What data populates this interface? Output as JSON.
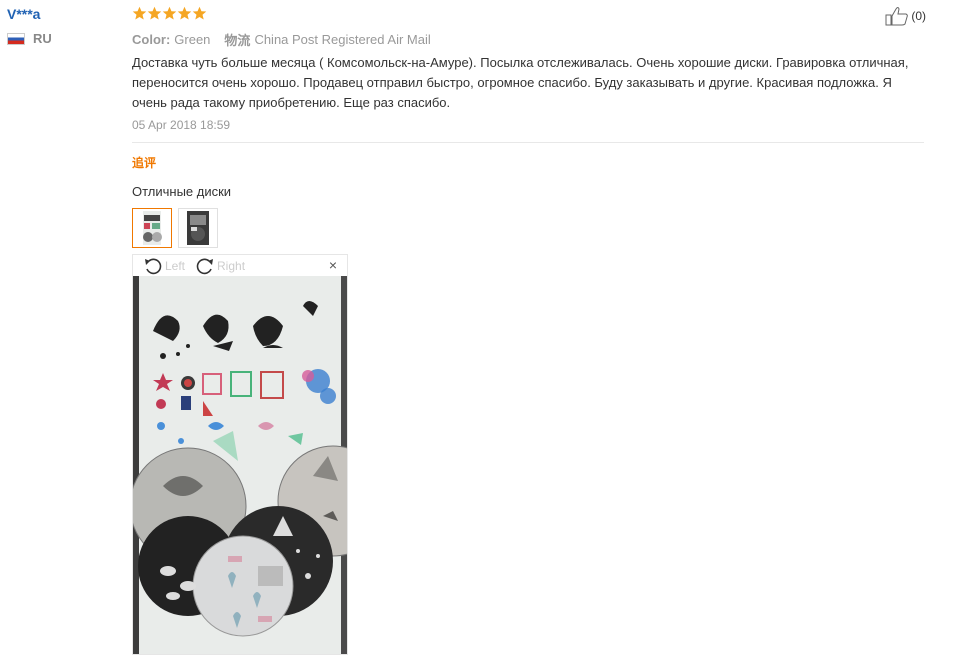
{
  "user": {
    "name": "V***a",
    "country": "RU"
  },
  "rating": {
    "stars": 5
  },
  "meta": {
    "color_label": "Color:",
    "color_value": "Green",
    "shipping_label": "物流",
    "shipping_value": "China Post Registered Air Mail"
  },
  "review": {
    "text": "Доставка чуть больше месяца ( Комсомольск-на-Амуре). Посылка отслеживалась. Очень хорошие диски. Гравировка отличная, переносится очень хорошо. Продавец отправил быстро, огромное спасибо. Буду заказывать и другие. Красивая подложка. Я очень рада такому приобретению. Еще раз спасибо.",
    "date": "05 Apr 2018 18:59"
  },
  "followup": {
    "title": "追评",
    "text": "Отличные диски"
  },
  "viewer": {
    "rotate_left": "Left",
    "rotate_right": "Right",
    "close": "×"
  },
  "like": {
    "count": "(0)"
  },
  "colors": {
    "accent": "#f07800",
    "username": "#2062b3",
    "star": "#f5a623"
  }
}
